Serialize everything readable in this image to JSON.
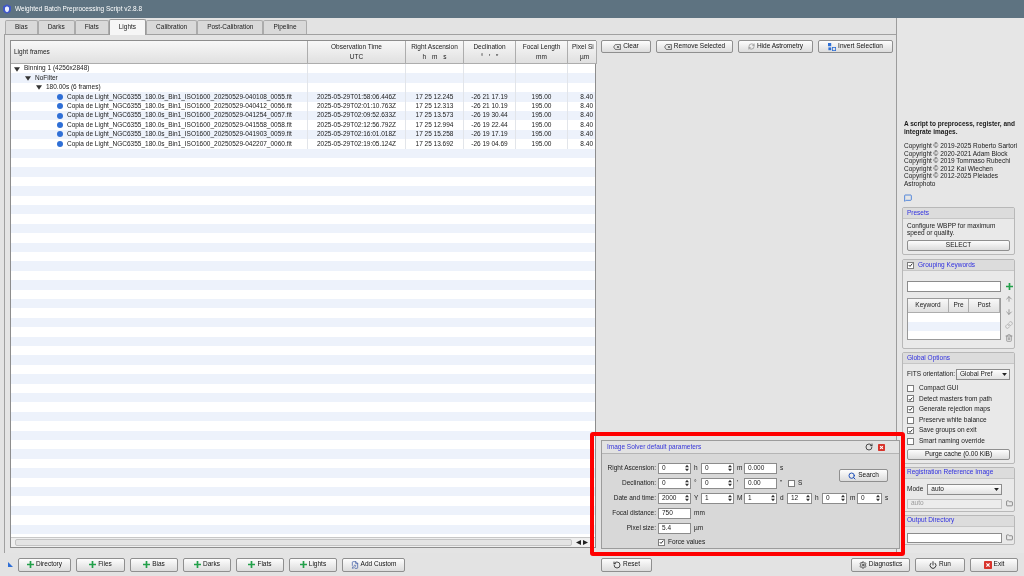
{
  "window": {
    "title": "Weighted Batch Preprocessing Script v2.8.8"
  },
  "tabs": [
    {
      "label": "Bias",
      "selected": false
    },
    {
      "label": "Darks",
      "selected": false
    },
    {
      "label": "Flats",
      "selected": false
    },
    {
      "label": "Lights",
      "selected": true
    },
    {
      "label": "Calibration",
      "selected": false
    },
    {
      "label": "Post-Calibration",
      "selected": false
    },
    {
      "label": "Pipeline",
      "selected": false
    }
  ],
  "frames_table": {
    "columns": [
      {
        "label": "Light frames"
      },
      {
        "label": "Observation Time",
        "unit": "UTC"
      },
      {
        "label": "Right Ascension",
        "unit": "h m s"
      },
      {
        "label": "Declination",
        "unit": "° ′ ″"
      },
      {
        "label": "Focal Length",
        "unit": "mm"
      },
      {
        "label": "Pixel Si",
        "unit": "µm"
      }
    ],
    "tree": [
      {
        "kind": "group",
        "label": "Binning 1 (4256x2848)",
        "expanded": true,
        "children": [
          {
            "kind": "group",
            "label": "NoFilter",
            "expanded": true,
            "children": [
              {
                "kind": "group",
                "label": "180.00s (6 frames)",
                "expanded": true,
                "children": [
                  {
                    "kind": "file",
                    "cells": [
                      "Copia de Light_NGC6355_180.0s_Bin1_ISO1600_20250529-040108_0055.fit",
                      "2025-05-29T01:58:06.446Z",
                      "17 25 12.245",
                      "-26 21 17.19",
                      "195.00",
                      "8.40"
                    ]
                  },
                  {
                    "kind": "file",
                    "cells": [
                      "Copia de Light_NGC6355_180.0s_Bin1_ISO1600_20250529-040412_0056.fit",
                      "2025-05-29T02:01:10.763Z",
                      "17 25 12.313",
                      "-26 21 10.19",
                      "195.00",
                      "8.40"
                    ]
                  },
                  {
                    "kind": "file",
                    "cells": [
                      "Copia de Light_NGC6355_180.0s_Bin1_ISO1600_20250529-041254_0057.fit",
                      "2025-05-29T02:09:52.633Z",
                      "17 25 13.573",
                      "-26 19 30.44",
                      "195.00",
                      "8.40"
                    ]
                  },
                  {
                    "kind": "file",
                    "cells": [
                      "Copia de Light_NGC6355_180.0s_Bin1_ISO1600_20250529-041558_0058.fit",
                      "2025-05-29T02:12:56.792Z",
                      "17 25 12.994",
                      "-26 19 22.44",
                      "195.00",
                      "8.40"
                    ]
                  },
                  {
                    "kind": "file",
                    "cells": [
                      "Copia de Light_NGC6355_180.0s_Bin1_ISO1600_20250529-041903_0059.fit",
                      "2025-05-29T02:16:01.018Z",
                      "17 25 15.258",
                      "-26 19 17.19",
                      "195.00",
                      "8.40"
                    ]
                  },
                  {
                    "kind": "file",
                    "cells": [
                      "Copia de Light_NGC6355_180.0s_Bin1_ISO1600_20250529-042207_0060.fit",
                      "2025-05-29T02:19:05.124Z",
                      "17 25 13.692",
                      "-26 19 04.69",
                      "195.00",
                      "8.40"
                    ]
                  }
                ]
              }
            ]
          }
        ]
      }
    ]
  },
  "table_buttons": [
    {
      "label": "Clear"
    },
    {
      "label": "Remove Selected"
    },
    {
      "label": "Hide Astrometry"
    },
    {
      "label": "Invert Selection"
    }
  ],
  "about": {
    "description": "A script to preprocess, register, and integrate images.",
    "copyright": [
      "Copyright © 2019-2025 Roberto Sartori",
      "Copyright © 2020-2021 Adam Block",
      "Copyright © 2019 Tommaso Rubechi",
      "Copyright © 2012 Kai Wiechen",
      "Copyright © 2012-2025 Pleiades Astrophoto"
    ]
  },
  "presets": {
    "title": "Presets",
    "text": "Configure WBPP for maximum speed or quality.",
    "button": "SELECT"
  },
  "grouping_keywords": {
    "title": "Grouping Keywords",
    "checked": true,
    "columns": [
      "Keyword",
      "Pre",
      "Post"
    ]
  },
  "global_options": {
    "title": "Global Options",
    "fits_orientation": {
      "label": "FITS orientation:",
      "value": "Global Pref"
    },
    "options": [
      {
        "label": "Compact GUI",
        "checked": false
      },
      {
        "label": "Detect masters from path",
        "checked": true
      },
      {
        "label": "Generate rejection maps",
        "checked": true
      },
      {
        "label": "Preserve white balance",
        "checked": false
      },
      {
        "label": "Save groups on exit",
        "checked": true
      },
      {
        "label": "Smart naming override",
        "checked": false
      }
    ],
    "button": "Purge cache (0.00 KiB)"
  },
  "image_solver": {
    "title": "Image Solver default parameters",
    "highlighted": true,
    "rows": [
      {
        "label": "Right Ascension:",
        "inputs": [
          {
            "kind": "spin",
            "value": "0",
            "unit": "h"
          },
          {
            "kind": "spin",
            "value": "0",
            "unit": "m"
          },
          {
            "kind": "text",
            "value": "0.000",
            "unit": "s"
          }
        ]
      },
      {
        "label": "Declination:",
        "inputs": [
          {
            "kind": "spin",
            "value": "0",
            "unit": "°"
          },
          {
            "kind": "spin",
            "value": "0",
            "unit": "'"
          },
          {
            "kind": "text",
            "value": "0.00",
            "unit": "\""
          },
          {
            "kind": "checkbox",
            "label": "S",
            "checked": false
          }
        ]
      },
      {
        "label": "Date and time:",
        "inputs": [
          {
            "kind": "spin",
            "value": "2000",
            "unit": "Y"
          },
          {
            "kind": "spin",
            "value": "1",
            "unit": "M"
          },
          {
            "kind": "spin",
            "value": "1",
            "unit": "d"
          },
          {
            "kind": "spin",
            "value": "12",
            "unit": "h"
          },
          {
            "kind": "spin",
            "value": "0",
            "unit": "m"
          },
          {
            "kind": "spin",
            "value": "0",
            "unit": "s"
          }
        ]
      },
      {
        "label": "Focal distance:",
        "inputs": [
          {
            "kind": "text",
            "value": "750",
            "unit": "mm"
          }
        ]
      },
      {
        "label": "Pixel size:",
        "inputs": [
          {
            "kind": "text",
            "value": "5.4",
            "unit": "µm"
          }
        ]
      }
    ],
    "force_values": {
      "label": "Force values",
      "checked": true
    },
    "search_button": "Search"
  },
  "registration_reference": {
    "title": "Registration Reference Image",
    "mode": {
      "label": "Mode",
      "value": "auto"
    },
    "file": {
      "value": "auto",
      "disabled": true
    }
  },
  "output_directory": {
    "title": "Output Directory"
  },
  "toolbar": {
    "add_buttons": [
      "Directory",
      "Files",
      "Bias",
      "Darks",
      "Flats",
      "Lights",
      "Add Custom"
    ],
    "reset": "Reset",
    "actions": [
      "Diagnostics",
      "Run",
      "Exit"
    ]
  }
}
